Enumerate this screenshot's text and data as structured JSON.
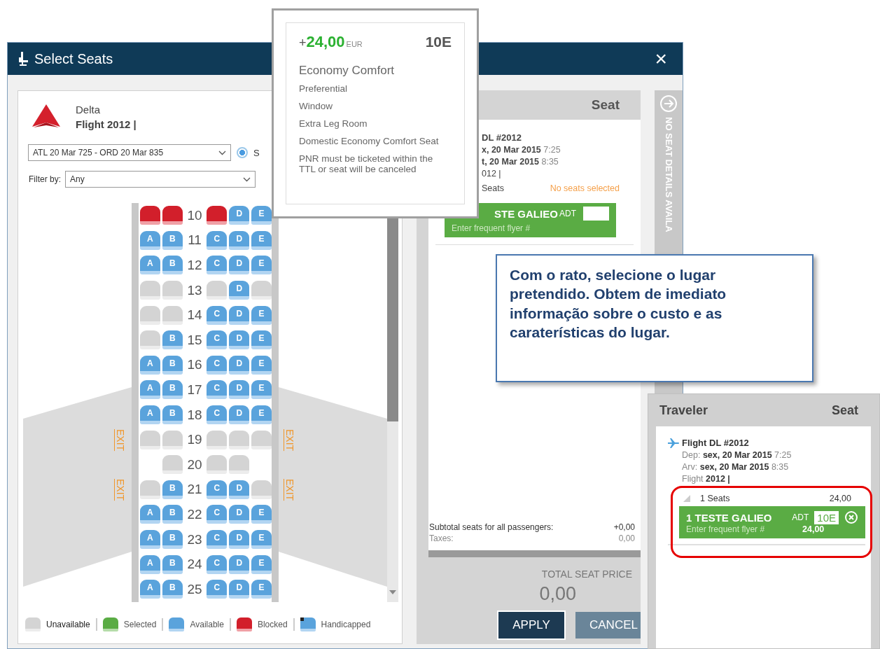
{
  "window": {
    "title": "Select Seats",
    "close": "×"
  },
  "flight_header": {
    "airline": "Delta",
    "flight": "Flight 2012 |"
  },
  "segment_select": {
    "value": "ATL 20 Mar 725 - ORD 20 Mar 835"
  },
  "segment_radio": {
    "label": "S",
    "selected": true
  },
  "filter": {
    "label": "Filter by:",
    "value": "Any"
  },
  "seat_map": {
    "rows": [
      {
        "number": "10",
        "seats": [
          {
            "kind": "blocked"
          },
          {
            "kind": "blocked"
          },
          {
            "kind": "blocked"
          },
          {
            "letter": "D",
            "kind": "available"
          },
          {
            "letter": "E",
            "kind": "available"
          }
        ]
      },
      {
        "number": "11",
        "seats": [
          {
            "letter": "A",
            "kind": "available"
          },
          {
            "letter": "B",
            "kind": "available"
          },
          {
            "letter": "C",
            "kind": "available"
          },
          {
            "letter": "D",
            "kind": "available"
          },
          {
            "letter": "E",
            "kind": "available"
          }
        ]
      },
      {
        "number": "12",
        "seats": [
          {
            "letter": "A",
            "kind": "available"
          },
          {
            "letter": "B",
            "kind": "available"
          },
          {
            "letter": "C",
            "kind": "available"
          },
          {
            "letter": "D",
            "kind": "available"
          },
          {
            "letter": "E",
            "kind": "available"
          }
        ]
      },
      {
        "number": "13",
        "seats": [
          {
            "kind": "unavailable"
          },
          {
            "kind": "unavailable"
          },
          {
            "kind": "unavailable"
          },
          {
            "letter": "D",
            "kind": "available"
          },
          {
            "kind": "unavailable"
          }
        ]
      },
      {
        "number": "14",
        "seats": [
          {
            "kind": "unavailable"
          },
          {
            "kind": "unavailable"
          },
          {
            "letter": "C",
            "kind": "available"
          },
          {
            "letter": "D",
            "kind": "available"
          },
          {
            "letter": "E",
            "kind": "available"
          }
        ]
      },
      {
        "number": "15",
        "seats": [
          {
            "kind": "unavailable"
          },
          {
            "letter": "B",
            "kind": "available"
          },
          {
            "letter": "C",
            "kind": "available"
          },
          {
            "letter": "D",
            "kind": "available"
          },
          {
            "letter": "E",
            "kind": "available"
          }
        ]
      },
      {
        "number": "16",
        "seats": [
          {
            "letter": "A",
            "kind": "available"
          },
          {
            "letter": "B",
            "kind": "available"
          },
          {
            "letter": "C",
            "kind": "available"
          },
          {
            "letter": "D",
            "kind": "available"
          },
          {
            "letter": "E",
            "kind": "available"
          }
        ]
      },
      {
        "number": "17",
        "seats": [
          {
            "letter": "A",
            "kind": "available"
          },
          {
            "letter": "B",
            "kind": "available"
          },
          {
            "letter": "C",
            "kind": "available"
          },
          {
            "letter": "D",
            "kind": "available"
          },
          {
            "letter": "E",
            "kind": "available"
          }
        ]
      },
      {
        "number": "18",
        "seats": [
          {
            "letter": "A",
            "kind": "available"
          },
          {
            "letter": "B",
            "kind": "available"
          },
          {
            "letter": "C",
            "kind": "available"
          },
          {
            "letter": "D",
            "kind": "available"
          },
          {
            "letter": "E",
            "kind": "available"
          }
        ]
      },
      {
        "number": "19",
        "exit_labels": [
          "EXIT",
          "EXIT"
        ],
        "seats": [
          {
            "kind": "unavailable"
          },
          {
            "kind": "unavailable"
          },
          {
            "kind": "unavailable"
          },
          {
            "kind": "unavailable"
          },
          {
            "kind": "unavailable"
          }
        ]
      },
      {
        "number": "20",
        "seats": [
          {
            "kind": "none"
          },
          {
            "kind": "unavailable"
          },
          {
            "kind": "unavailable"
          },
          {
            "kind": "unavailable"
          },
          {
            "kind": "none"
          }
        ]
      },
      {
        "number": "21",
        "exit_labels": [
          "EXIT",
          "EXIT"
        ],
        "seats": [
          {
            "kind": "unavailable"
          },
          {
            "letter": "B",
            "kind": "available"
          },
          {
            "letter": "C",
            "kind": "available"
          },
          {
            "letter": "D",
            "kind": "available"
          },
          {
            "kind": "unavailable"
          }
        ]
      },
      {
        "number": "22",
        "seats": [
          {
            "letter": "A",
            "kind": "available"
          },
          {
            "letter": "B",
            "kind": "available"
          },
          {
            "letter": "C",
            "kind": "available"
          },
          {
            "letter": "D",
            "kind": "available"
          },
          {
            "letter": "E",
            "kind": "available"
          }
        ]
      },
      {
        "number": "23",
        "seats": [
          {
            "letter": "A",
            "kind": "available"
          },
          {
            "letter": "B",
            "kind": "available"
          },
          {
            "letter": "C",
            "kind": "available"
          },
          {
            "letter": "D",
            "kind": "available"
          },
          {
            "letter": "E",
            "kind": "available"
          }
        ]
      },
      {
        "number": "24",
        "seats": [
          {
            "letter": "A",
            "kind": "available"
          },
          {
            "letter": "B",
            "kind": "available"
          },
          {
            "letter": "C",
            "kind": "available"
          },
          {
            "letter": "D",
            "kind": "available"
          },
          {
            "letter": "E",
            "kind": "available"
          }
        ]
      },
      {
        "number": "25",
        "seats": [
          {
            "letter": "A",
            "kind": "available"
          },
          {
            "letter": "B",
            "kind": "available"
          },
          {
            "letter": "C",
            "kind": "available"
          },
          {
            "letter": "D",
            "kind": "available"
          },
          {
            "letter": "E",
            "kind": "available"
          }
        ]
      }
    ]
  },
  "legend": [
    {
      "kind": "unavailable",
      "label": "Unavailable"
    },
    {
      "kind": "selected",
      "label": "Selected"
    },
    {
      "kind": "available",
      "label": "Available"
    },
    {
      "kind": "blocked",
      "label": "Blocked"
    },
    {
      "kind": "handicapped",
      "label": "Handicapped"
    }
  ],
  "passenger_panel": {
    "header_seat": "Seat",
    "flight": "DL #2012",
    "dep_date": "x, 20 Mar 2015",
    "dep_time": "7:25",
    "arr_date": "t, 20 Mar 2015",
    "arr_time": "8:35",
    "flight_number": "012 |",
    "seats_label": "Seats",
    "seats_status": "No seats selected",
    "passenger": {
      "name": "STE GALIEO",
      "type": "ADT",
      "ff_placeholder": "Enter frequent flyer #"
    },
    "subtotal_label": "Subtotal seats for all passengers:",
    "subtotal_value": "+0,00",
    "taxes_label": "Taxes:",
    "taxes_value": "0,00",
    "total_label": "TOTAL SEAT PRICE",
    "total_value": "0,00",
    "buttons": [
      {
        "label": "APPLY",
        "kind": "primary"
      },
      {
        "label": "CANCEL",
        "kind": "secondary"
      }
    ]
  },
  "details_strip": {
    "text": "NO SEAT DETAILS AVAILA"
  },
  "tooltip": {
    "sign": "+",
    "price": "24,00",
    "currency": "EUR",
    "seat": "10E",
    "seat_class": "Economy Comfort",
    "features": [
      "Preferential",
      "Window",
      "Extra Leg Room",
      "Domestic Economy Comfort Seat",
      "PNR must be ticketed within the TTL or seat will be canceled"
    ]
  },
  "callout": {
    "text": "Com o rato, selecione o lugar pretendido. Obtem de imediato informação sobre o custo e as caraterísticas do lugar."
  },
  "inset": {
    "header_traveler": "Traveler",
    "header_seat": "Seat",
    "flight": "Flight DL #2012",
    "dep_label": "Dep:",
    "dep_date": "sex, 20 Mar 2015",
    "dep_time": "7:25",
    "arr_label": "Arv:",
    "arr_date": "sex, 20 Mar 2015",
    "arr_time": "8:35",
    "flight_label": "Flight",
    "flight_number": "2012 |",
    "seats_label": "1 Seats",
    "seats_total": "24,00",
    "expanded": true,
    "passenger": {
      "index": "1",
      "name": "TESTE GALIEO",
      "type": "ADT",
      "seat": "10E",
      "ff_placeholder": "Enter frequent flyer #",
      "price": "24,00"
    }
  }
}
